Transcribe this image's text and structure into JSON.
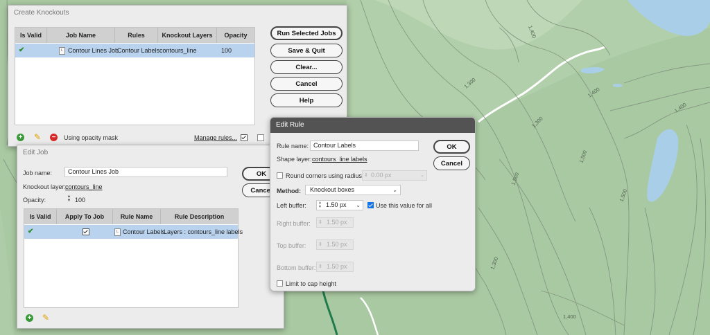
{
  "map": {
    "contour_labels": [
      "1,400",
      "1,300",
      "1,400",
      "1,400",
      "1,300",
      "1,500",
      "1,500",
      "1,500",
      "1,300",
      "1,400"
    ]
  },
  "create_knockouts": {
    "title": "Create Knockouts",
    "columns": [
      "Is Valid",
      "Job Name",
      "Rules",
      "Knockout Layers",
      "Opacity"
    ],
    "rows": [
      {
        "job_name": "Contour Lines Job",
        "rules": "Contour Labels",
        "knockout_layers": "contours_line",
        "opacity": "100"
      }
    ],
    "buttons": {
      "run": "Run Selected Jobs",
      "save_quit": "Save & Quit",
      "clear": "Clear...",
      "cancel": "Cancel",
      "help": "Help"
    },
    "opacity_mask_label": "Using opacity mask",
    "manage_rules": "Manage rules..."
  },
  "edit_job": {
    "title": "Edit Job",
    "job_name_label": "Job name:",
    "job_name_value": "Contour Lines Job",
    "knockout_layer_label": "Knockout layer:",
    "knockout_layer_value": "contours_line",
    "opacity_label": "Opacity:",
    "opacity_value": "100",
    "columns": [
      "Is Valid",
      "Apply To Job",
      "Rule Name",
      "Rule Description"
    ],
    "rows": [
      {
        "rule_name": "Contour Labels",
        "rule_description": "Layers : contours_line labels"
      }
    ],
    "ok": "OK",
    "cancel": "Cancel"
  },
  "edit_rule": {
    "title": "Edit Rule",
    "rule_name_label": "Rule name:",
    "rule_name_value": "Contour Labels",
    "shape_layer_label": "Shape layer:",
    "shape_layer_value": "contours_line labels",
    "round_corners_label": "Round corners using radius:",
    "round_corners_value": "0.00 px",
    "method_label": "Method:",
    "method_value": "Knockout boxes",
    "left_buffer_label": "Left buffer:",
    "left_buffer_value": "1.50 px",
    "use_all_label": "Use this value for all",
    "right_buffer_label": "Right buffer:",
    "right_buffer_value": "1.50 px",
    "top_buffer_label": "Top buffer:",
    "top_buffer_value": "1.50 px",
    "bottom_buffer_label": "Bottom buffer:",
    "bottom_buffer_value": "1.50 px",
    "limit_cap_label": "Limit to cap height",
    "ok": "OK",
    "cancel": "Cancel"
  }
}
